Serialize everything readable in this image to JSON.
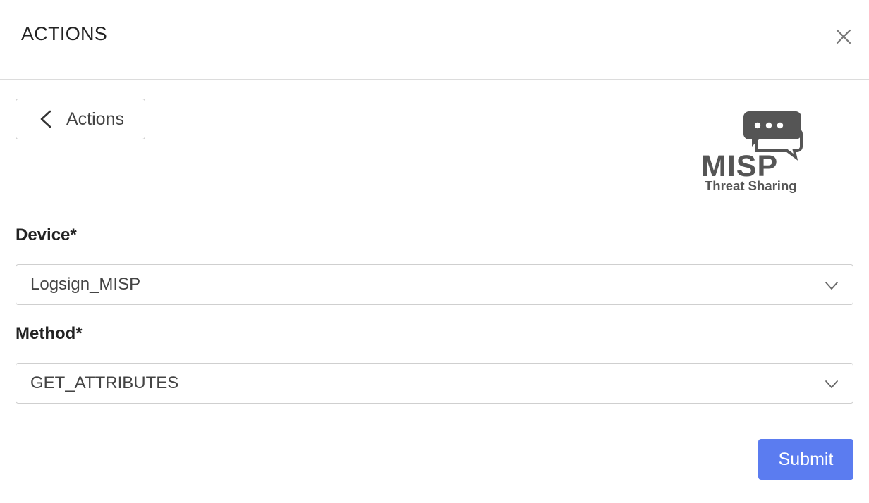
{
  "header": {
    "title": "ACTIONS",
    "close_icon": "close-icon"
  },
  "back_button": {
    "label": "Actions",
    "icon": "chevron-left-icon"
  },
  "logo": {
    "text": "MISP",
    "subtext": "Threat Sharing",
    "icon": "chat-bubbles-icon",
    "color": "#555555"
  },
  "fields": {
    "device": {
      "label": "Device*",
      "value": "Logsign_MISP"
    },
    "method": {
      "label": "Method*",
      "value": "GET_ATTRIBUTES"
    }
  },
  "submit": {
    "label": "Submit",
    "color": "#5b7cf0"
  }
}
